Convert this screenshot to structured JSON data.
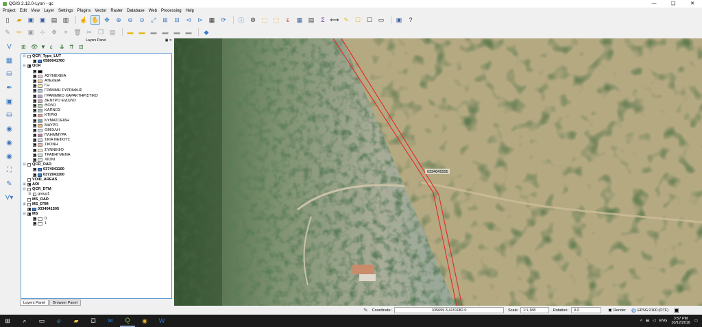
{
  "window": {
    "title": "QGIS 2.12.0-Lyon - qc",
    "controls": [
      "—",
      "❏",
      "✕"
    ]
  },
  "menu": [
    "Project",
    "Edit",
    "View",
    "Layer",
    "Settings",
    "Plugins",
    "Vector",
    "Raster",
    "Database",
    "Web",
    "Processing",
    "Help"
  ],
  "layers_panel": {
    "title": "Layers Panel",
    "rows": [
      {
        "label": "QCR_Type_LUT",
        "level": 0,
        "bold": true,
        "expander": "⊟",
        "checked": false,
        "icon": "none"
      },
      {
        "label": "0580041760",
        "level": 1,
        "bold": true,
        "expander": "",
        "checked": true,
        "icon": "raster"
      },
      {
        "label": "QCR",
        "level": 0,
        "bold": true,
        "expander": "⊟",
        "checked": true,
        "icon": "none"
      },
      {
        "label": "",
        "level": 1,
        "bold": false,
        "expander": "",
        "checked": true,
        "icon": "swatch",
        "color": "#000000"
      },
      {
        "label": "ΑΣΥΝΕΧΕΙΑ",
        "level": 1,
        "bold": false,
        "expander": "",
        "checked": true,
        "icon": "swatch",
        "color": "#f4cccc"
      },
      {
        "label": "ΑΤΕΛΕΙΑ",
        "level": 1,
        "bold": false,
        "expander": "",
        "checked": true,
        "icon": "swatch",
        "color": "#f9cb9c"
      },
      {
        "label": "ΓΗ",
        "level": 1,
        "bold": false,
        "expander": "",
        "checked": true,
        "icon": "swatch",
        "color": "#ffe599"
      },
      {
        "label": "ΓΡΑΜΜΗ ΣΥΡΡΑΦΗΣ",
        "level": 1,
        "bold": false,
        "expander": "",
        "checked": true,
        "icon": "swatch",
        "color": "#9fc5e8"
      },
      {
        "label": "ΓΡΑΜΜΙΚΟ ΧΑΡΑΚΤΗΡΙΣΤΙΚΟ",
        "level": 1,
        "bold": false,
        "expander": "",
        "checked": true,
        "icon": "swatch",
        "color": "#b4a7d6"
      },
      {
        "label": "ΔΕΝΤΡΟ ΕΙΔΩΛΟ",
        "level": 1,
        "bold": false,
        "expander": "",
        "checked": true,
        "icon": "swatch",
        "color": "#d5a6bd"
      },
      {
        "label": "ΘΟΛΟ",
        "level": 1,
        "bold": false,
        "expander": "",
        "checked": true,
        "icon": "swatch",
        "color": "#b6d7a8"
      },
      {
        "label": "ΚΑΠΝΟΣ",
        "level": 1,
        "bold": false,
        "expander": "",
        "checked": true,
        "icon": "swatch",
        "color": "#a2c4c9"
      },
      {
        "label": "ΚΤΙΡΙΟ",
        "level": 1,
        "bold": false,
        "expander": "",
        "checked": true,
        "icon": "swatch",
        "color": "#ea9999"
      },
      {
        "label": "ΚΥΜΑΤΟΕΙΔΗ",
        "level": 1,
        "bold": false,
        "expander": "",
        "checked": true,
        "icon": "swatch",
        "color": "#76a5af"
      },
      {
        "label": "ΜΑΥΡΟ",
        "level": 1,
        "bold": false,
        "expander": "",
        "checked": true,
        "icon": "swatch",
        "color": "#f6b26b"
      },
      {
        "label": "ΟΜΙΧΛΗ",
        "level": 1,
        "bold": false,
        "expander": "",
        "checked": true,
        "icon": "swatch",
        "color": "#cfe2f3"
      },
      {
        "label": "ΠΛΗΜΜΥΡΑ",
        "level": 1,
        "bold": false,
        "expander": "",
        "checked": true,
        "icon": "swatch",
        "color": "#c27ba0"
      },
      {
        "label": "ΣΚΙΑ ΝΕΦΟΥΣ",
        "level": 1,
        "bold": false,
        "expander": "",
        "checked": true,
        "icon": "swatch",
        "color": "#d9d2e9"
      },
      {
        "label": "ΣΚΟΝΗ",
        "level": 1,
        "bold": false,
        "expander": "",
        "checked": true,
        "icon": "swatch",
        "color": "#e6b8af"
      },
      {
        "label": "ΣΥΝΝΕΦΟ",
        "level": 1,
        "bold": false,
        "expander": "",
        "checked": true,
        "icon": "swatch",
        "color": "#fff2cc"
      },
      {
        "label": "ΤΡΑΒΗΓΜΕΝΑ",
        "level": 1,
        "bold": false,
        "expander": "",
        "checked": true,
        "icon": "swatch",
        "color": "#d0e0e3"
      },
      {
        "label": "ΧΙΟΝΙ",
        "level": 1,
        "bold": false,
        "expander": "",
        "checked": true,
        "icon": "swatch",
        "color": "#d9ead3"
      },
      {
        "label": "QCR_OAD",
        "level": 0,
        "bold": true,
        "expander": "⊟",
        "checked": false,
        "icon": "none"
      },
      {
        "label": "0374041100",
        "level": 1,
        "bold": true,
        "expander": "",
        "checked": true,
        "icon": "raster"
      },
      {
        "label": "0372041100",
        "level": 1,
        "bold": true,
        "expander": "",
        "checked": true,
        "icon": "raster"
      },
      {
        "label": "VOID_AREAS",
        "level": 0,
        "bold": true,
        "expander": "",
        "checked": false,
        "icon": "none"
      },
      {
        "label": "AOI",
        "level": 0,
        "bold": true,
        "expander": "⊞",
        "checked": true,
        "icon": "none"
      },
      {
        "label": "QCR_DTM",
        "level": 0,
        "bold": true,
        "expander": "⊟",
        "checked": false,
        "icon": "none"
      },
      {
        "label": "group1",
        "level": 1,
        "bold": false,
        "expander": "⊞",
        "checked": false,
        "icon": "none"
      },
      {
        "label": "MS_OAD",
        "level": 0,
        "bold": true,
        "expander": "",
        "checked": false,
        "icon": "none"
      },
      {
        "label": "MS_DTM",
        "level": 0,
        "bold": true,
        "expander": "⊞",
        "checked": false,
        "icon": "none"
      },
      {
        "label": "0334041505",
        "level": 0,
        "bold": true,
        "expander": "",
        "checked": true,
        "icon": "raster"
      },
      {
        "label": "MS",
        "level": 0,
        "bold": true,
        "expander": "⊟",
        "checked": true,
        "icon": "none"
      },
      {
        "label": "0",
        "level": 1,
        "bold": false,
        "expander": "",
        "checked": true,
        "icon": "swatch",
        "color": "#ffffff"
      },
      {
        "label": "1",
        "level": 1,
        "bold": false,
        "expander": "",
        "checked": true,
        "icon": "swatch",
        "color": "#ffffff"
      }
    ],
    "tabs": [
      "Layers Panel",
      "Browser Panel"
    ]
  },
  "map": {
    "label": "0334041505",
    "boundary_color": "#e03030"
  },
  "statusbar": {
    "coordinate_label": "Coordinate:",
    "coordinate_value": "335699.3,4151082.0",
    "scale_label": "Scale",
    "scale_value": "1:1,188",
    "rotation_label": "Rotation:",
    "rotation_value": "0.0",
    "render_label": "Render",
    "crs": "EPSG:2100 (OTF)"
  },
  "taskbar": {
    "language": "ENG",
    "time": "3:57 PM",
    "date": "10/12/2016"
  }
}
